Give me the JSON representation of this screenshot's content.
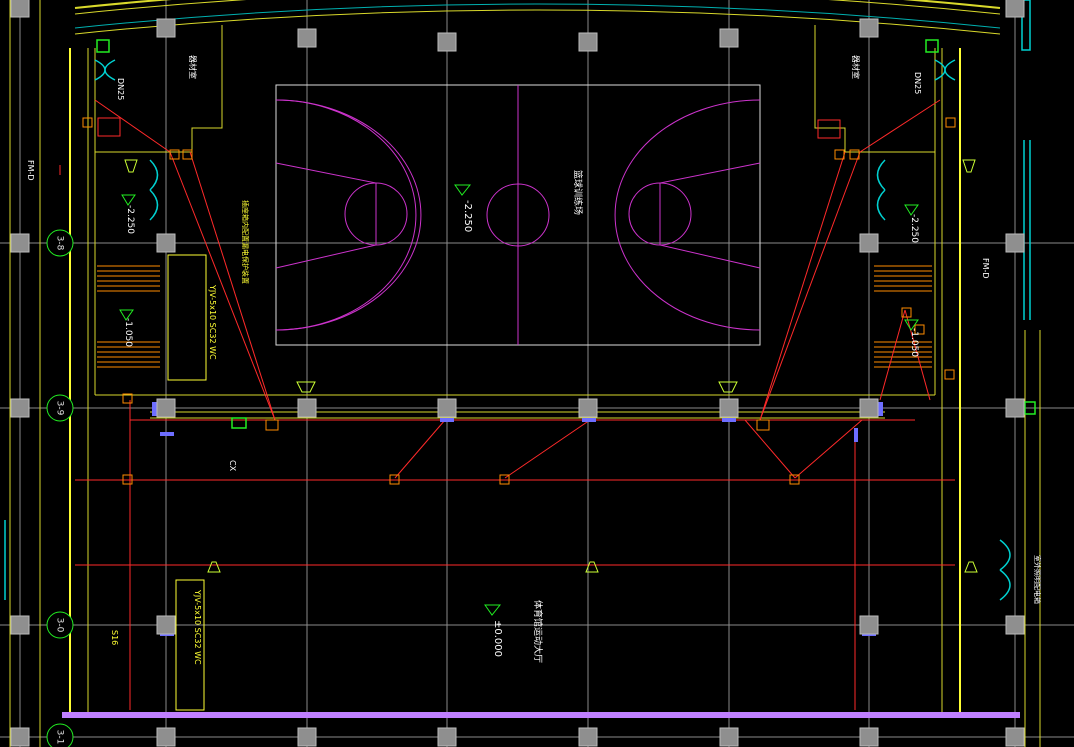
{
  "colors": {
    "background": "#000000",
    "grid": "#8a8a8a",
    "wall": "#d9d92b",
    "wall_bright": "#ffff33",
    "court": "#dcdcdc",
    "court_lines": "#cc33cc",
    "electric": "#ff2a2a",
    "device": "#ff8c00",
    "cyan": "#00d0d0",
    "green": "#22ee22",
    "column": "#8f8f8f",
    "purple_band": "#c080ff",
    "blue_device": "#6e6eff"
  },
  "grid_axes": {
    "axis_1": "3-8",
    "axis_2": "3-9",
    "axis_3": "3-0",
    "axis_4": "3-1"
  },
  "labels": {
    "court_name": "篮球训练场",
    "court_elevation": "-2.250",
    "floor_elevation": "±0.000",
    "hall_name": "体育馆运动大厅",
    "left_upper_elevation": "-2.250",
    "right_upper_elevation": "-2.250",
    "left_stair_elevation": "-1.050",
    "right_stair_elevation": "-1.050",
    "left_room": "器材室",
    "right_room": "器材室",
    "left_dn": "DN25",
    "right_dn": "DN25",
    "left_fm": "FM-D",
    "right_fm": "FM-D",
    "cable_note_a": "YJV-5x10 SC32 WC",
    "cable_note_b": "YJV-5x10 SC32 WC",
    "cable_tag": "CX",
    "switch_tag": "S16",
    "feeder_note": "插座箱内配置漏电保护装置",
    "right_edge_tag": "室外照明配电箱"
  }
}
